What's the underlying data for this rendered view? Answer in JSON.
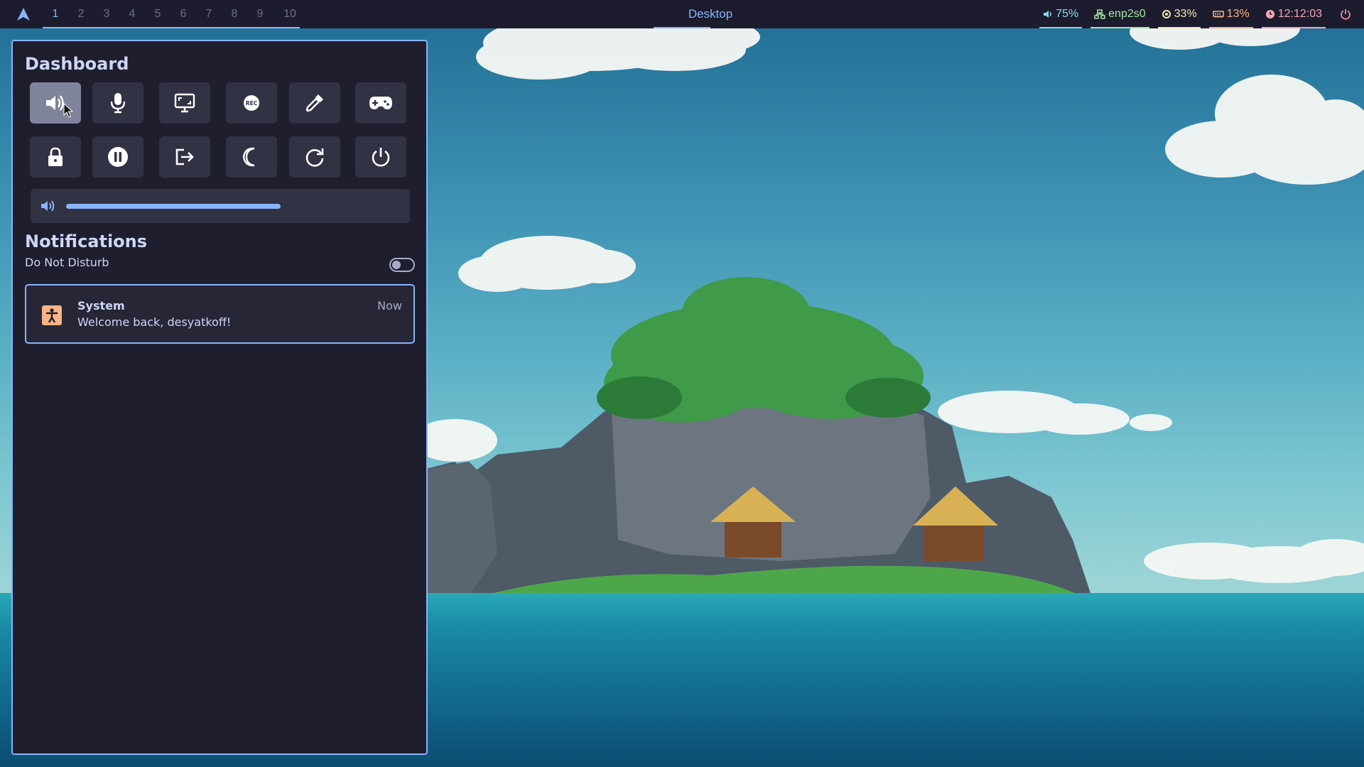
{
  "topbar": {
    "workspaces": [
      "1",
      "2",
      "3",
      "4",
      "5",
      "6",
      "7",
      "8",
      "9",
      "10"
    ],
    "active_workspace": "1",
    "window_title": "Desktop",
    "volume": "75%",
    "network": "enp2s0",
    "cpu": "33%",
    "memory": "13%",
    "clock": "12:12:03"
  },
  "dashboard": {
    "title": "Dashboard",
    "row1_icons": [
      "volume-icon",
      "microphone-icon",
      "screenshot-icon",
      "record-icon",
      "color-picker-icon",
      "gamepad-icon"
    ],
    "row2_icons": [
      "lock-icon",
      "pause-icon",
      "logout-icon",
      "sleep-icon",
      "reboot-icon",
      "power-icon"
    ],
    "volume_level": 0.65
  },
  "notifications": {
    "title": "Notifications",
    "dnd_label": "Do Not Disturb",
    "dnd_enabled": false,
    "items": [
      {
        "app": "System",
        "body": "Welcome back, desyatkoff!",
        "time": "Now",
        "icon": "accessibility-icon"
      }
    ]
  },
  "colors": {
    "accent": "#89b4fa",
    "panel_bg": "#1e1e2e",
    "button_bg": "#313244"
  }
}
